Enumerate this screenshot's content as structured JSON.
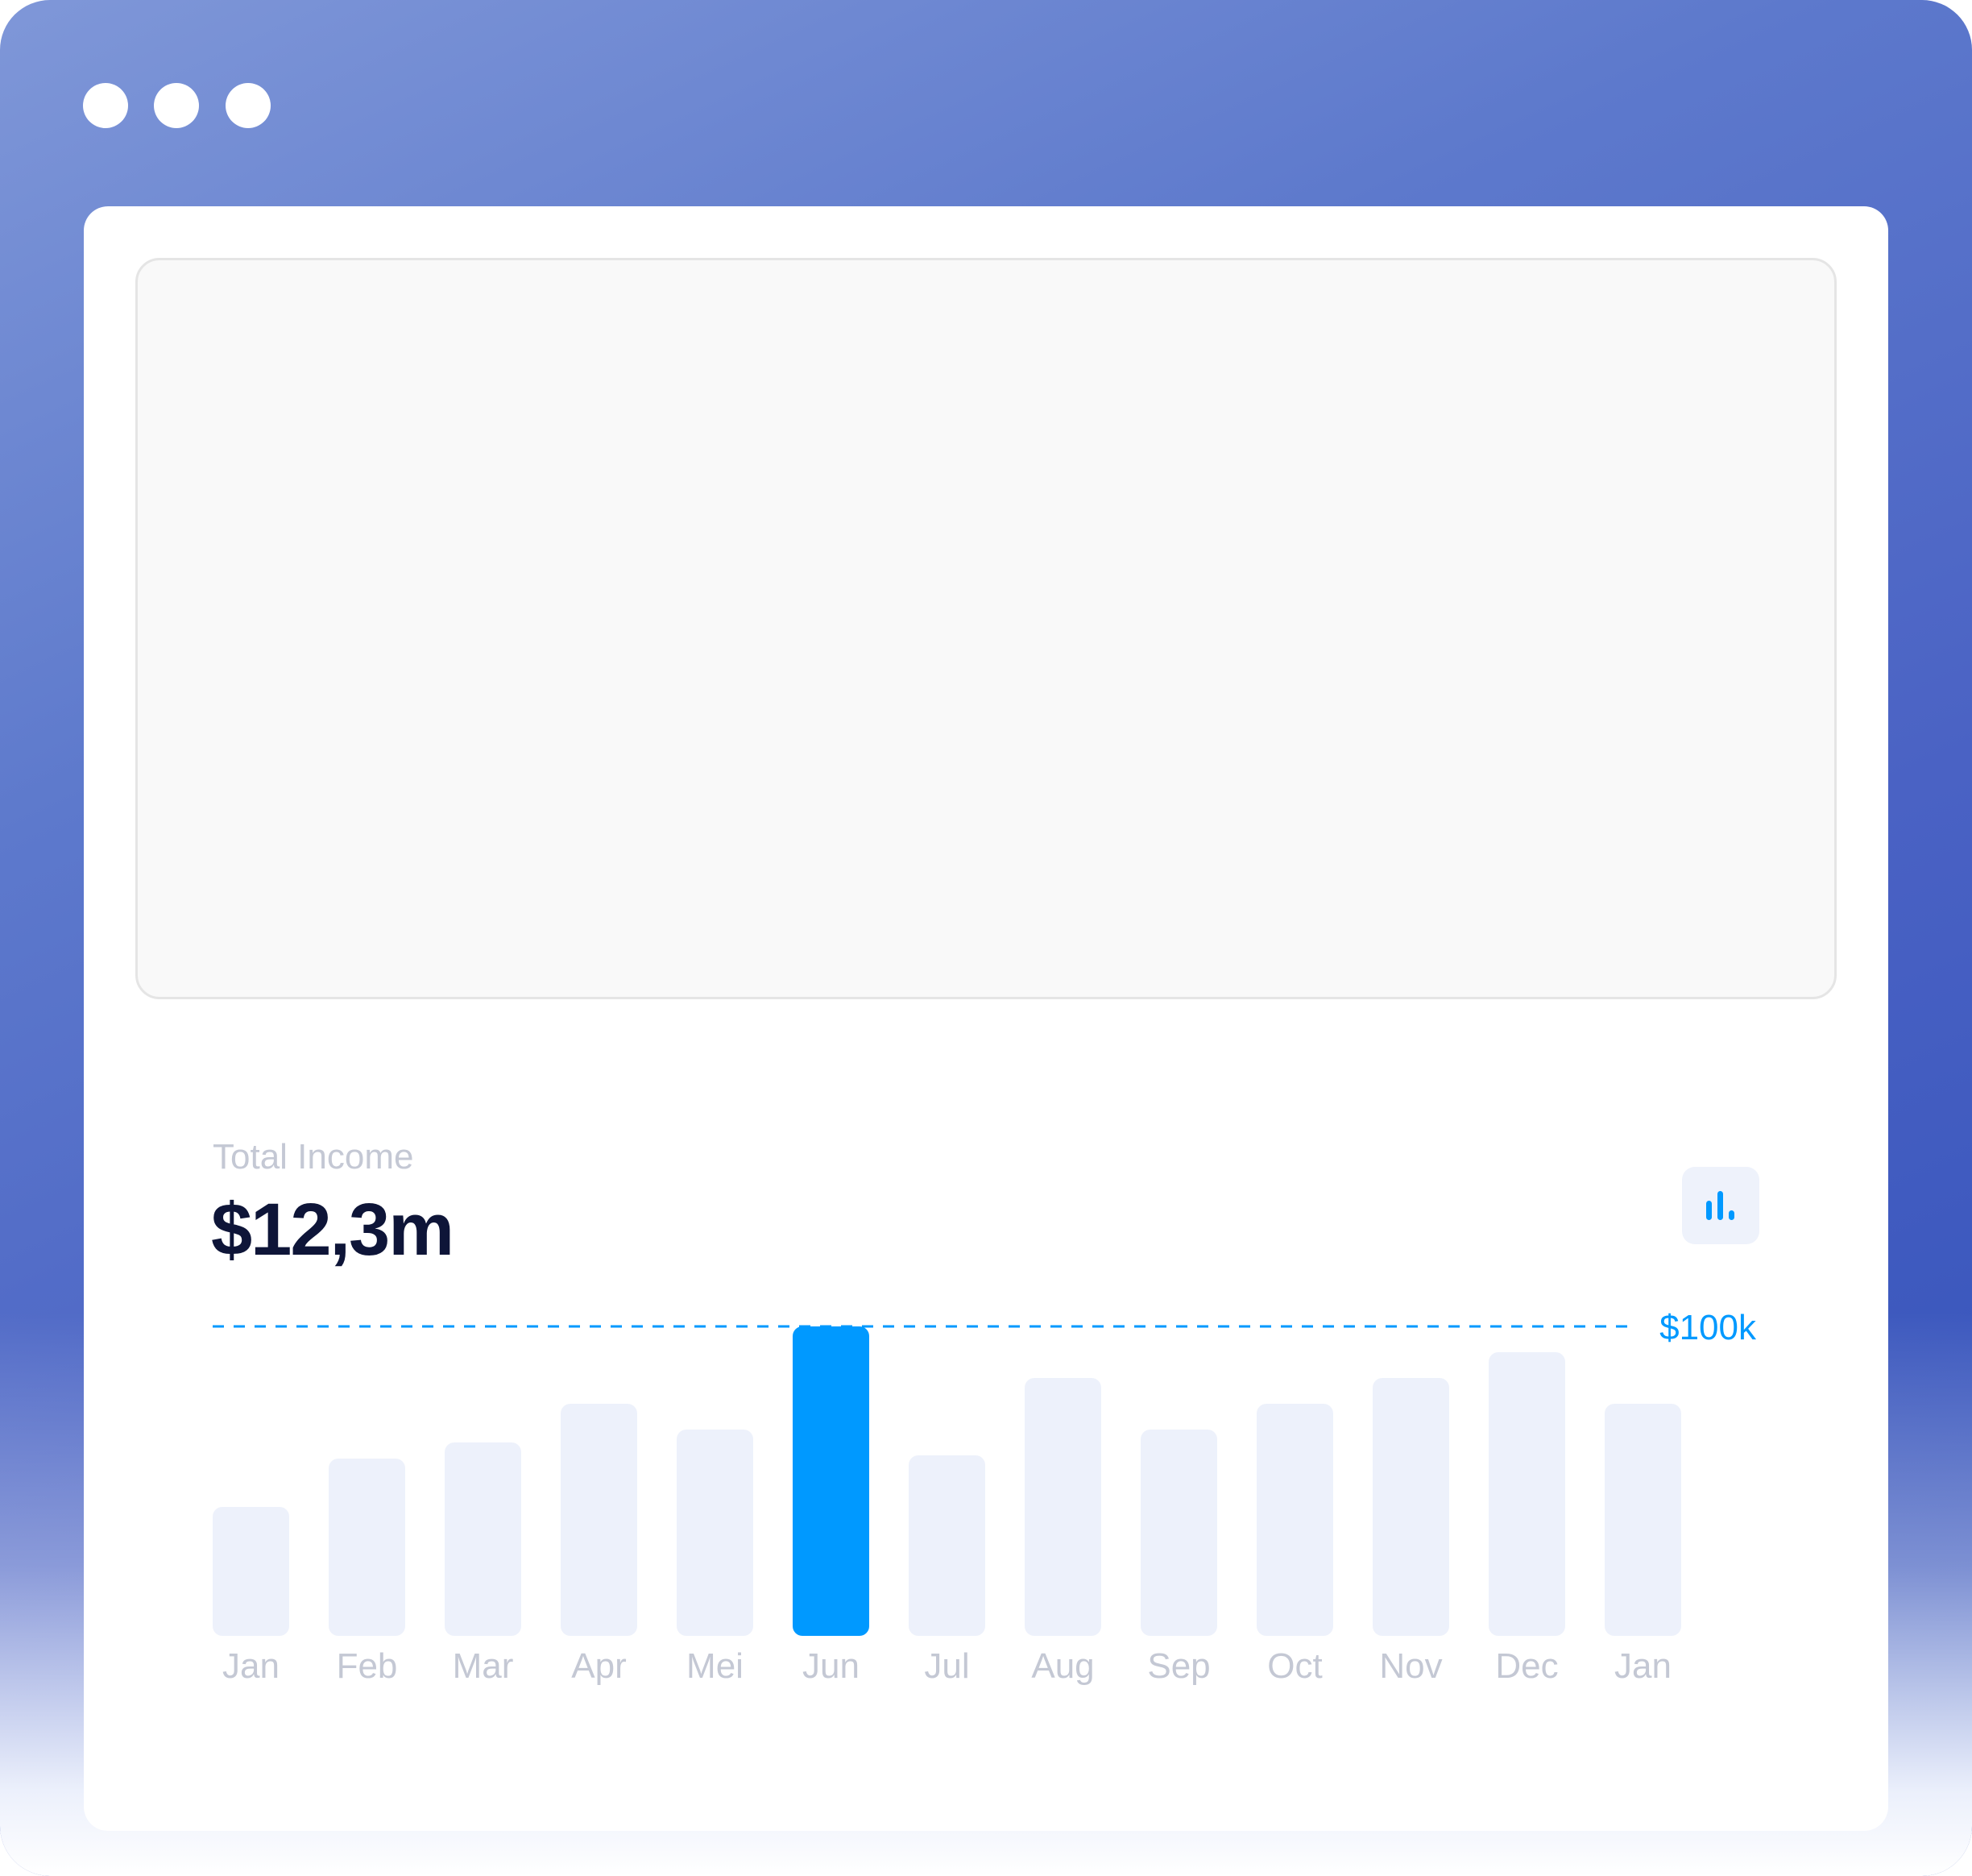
{
  "window": {
    "controls": [
      "window-dot",
      "window-dot",
      "window-dot"
    ]
  },
  "summary": {
    "label": "Total Income",
    "value": "$12,3m"
  },
  "toolbar": {
    "chart_toggle_icon": "bar-chart-icon"
  },
  "colors": {
    "accent": "#0099ff",
    "bar_muted": "#edf1fb",
    "title": "#0e1538",
    "label_muted": "#c4c8d4"
  },
  "chart_data": {
    "type": "bar",
    "categories": [
      "Jan",
      "Feb",
      "Mar",
      "Apr",
      "Mei",
      "Jun",
      "Jul",
      "Aug",
      "Sep",
      "Oct",
      "Nov",
      "Dec",
      "Jan"
    ],
    "values": [
      40,
      55,
      60,
      72,
      64,
      96,
      56,
      80,
      64,
      72,
      80,
      88,
      72
    ],
    "highlight_index": 5,
    "reference_line": {
      "value": 96,
      "label": "$100k"
    },
    "ylim": [
      0,
      100
    ],
    "title": "",
    "xlabel": "",
    "ylabel": "",
    "grid": false
  }
}
